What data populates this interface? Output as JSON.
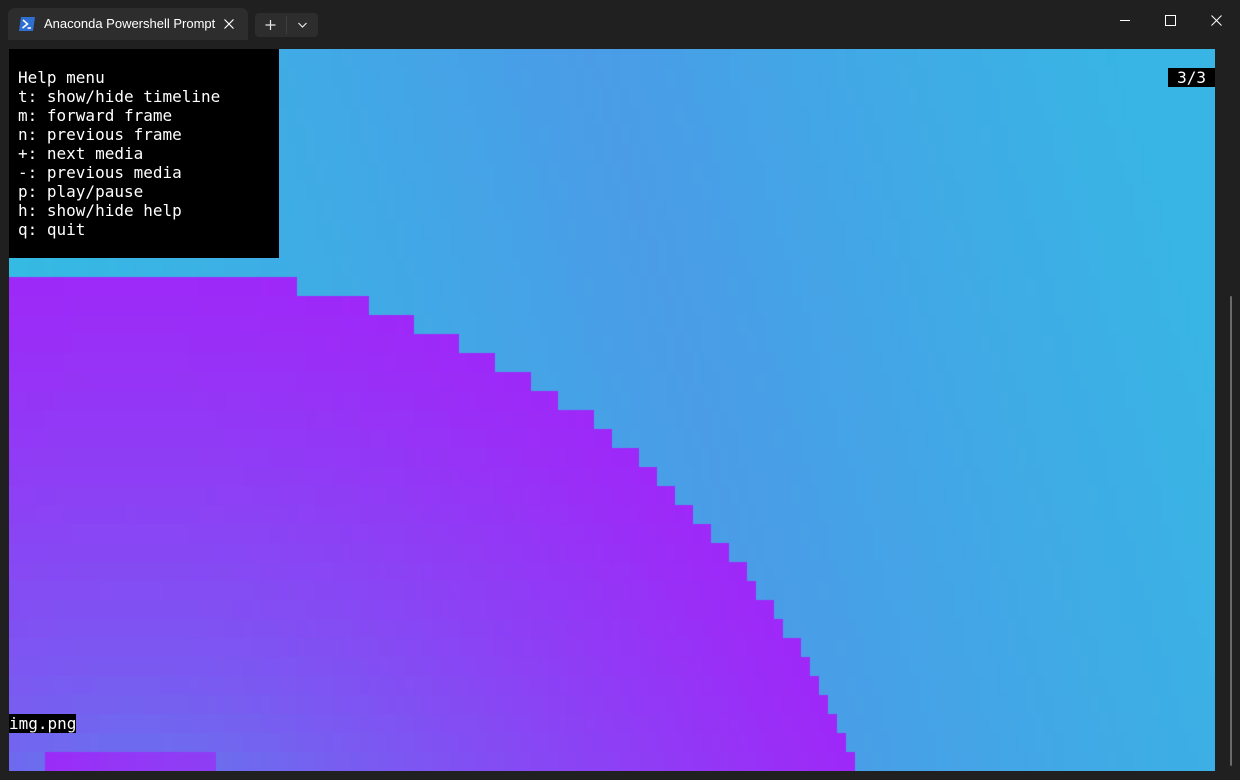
{
  "window": {
    "tab_title": "Anaconda Powershell Prompt",
    "tab_icon": "powershell-icon"
  },
  "help": {
    "title": "Help menu",
    "lines": [
      "t: show/hide timeline",
      "m: forward frame",
      "n: previous frame",
      "+: next media",
      "-: previous media",
      "p: play/pause",
      "h: show/hide help",
      "q: quit"
    ]
  },
  "viewer": {
    "counter": "3/3",
    "filename": "img.png"
  },
  "colors": {
    "background_cyan": "#2ec3e2",
    "blob_purple": "#9e28f8",
    "help_bg": "#000000",
    "text": "#ffffff"
  }
}
